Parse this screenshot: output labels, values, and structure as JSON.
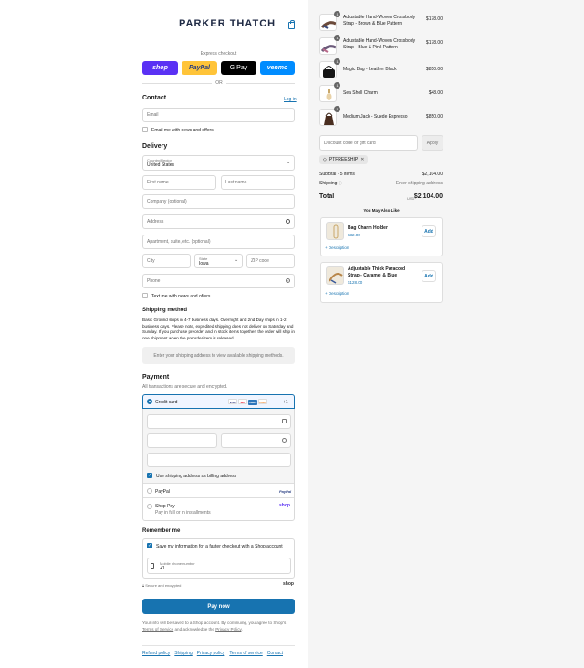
{
  "brand": {
    "logo": "PARKER THATCH"
  },
  "express": {
    "label": "Express checkout",
    "buttons": [
      {
        "label": "shop",
        "color": "#5a31f4"
      },
      {
        "label": "PayPal",
        "color": "#ffc439"
      },
      {
        "label": "G Pay",
        "color": "#000000"
      },
      {
        "label": "venmo",
        "color": "#008cff"
      }
    ],
    "or": "OR"
  },
  "contact": {
    "heading": "Contact",
    "login": "Log in",
    "email_placeholder": "Email",
    "news_label": "Email me with news and offers"
  },
  "delivery": {
    "heading": "Delivery",
    "country_label": "Country/Region",
    "country_value": "United States",
    "first_name": "First name",
    "last_name": "Last name",
    "company": "Company (optional)",
    "address": "Address",
    "apartment": "Apartment, suite, etc. (optional)",
    "city": "City",
    "state_label": "State",
    "state_value": "Iowa",
    "zip": "ZIP code",
    "phone": "Phone",
    "text_label": "Text me with news and offers"
  },
  "shipping": {
    "heading": "Shipping method",
    "body": "Basic Ground ships in 4-7 business days. Overnight and 2nd Day ships in 1-2 business days. Please note, expedited shipping does not deliver on Saturday and Sunday. If you purchase preorder and in stock items together, the order will ship in one shipment when the preorder item is released.",
    "note": "Enter your shipping address to view available shipping methods."
  },
  "payment": {
    "heading": "Payment",
    "sub": "All transactions are secure and encrypted.",
    "credit_card": "Credit card",
    "cards": [
      "VISA",
      "MC",
      "AMEX",
      "DISC"
    ],
    "more_cards": "+1",
    "billing_label": "Use shipping address as billing address",
    "paypal": "PayPal",
    "paypal_logo": "PayPal",
    "shop_pay": "Shop Pay",
    "shop_pay_sub": "Pay in full or in installments",
    "shop_logo": "shop"
  },
  "remember": {
    "heading": "Remember me",
    "save_label": "Save my information for a faster checkout with a Shop account",
    "phone_label": "Mobile phone number",
    "phone_value": "+1",
    "secure": "Secure and encrypted",
    "shop": "shop"
  },
  "pay_now": "Pay now",
  "legal": {
    "text1": "Your info will be saved to a Shop account. By continuing, you agree to Shop's",
    "terms": "Terms of Service",
    "text2": "and acknowledge the",
    "privacy": "Privacy Policy",
    "text3": "."
  },
  "footer_links": [
    "Refund policy",
    "Shipping",
    "Privacy policy",
    "Terms of service",
    "Contact"
  ],
  "cart": {
    "items": [
      {
        "name": "Adjustable Hand-Woven Crossbody Strap - Brown & Blue Pattern",
        "price": "$178.00",
        "qty": "1"
      },
      {
        "name": "Adjustable Hand-Woven Crossbody Strap - Blue & Pink Pattern",
        "price": "$178.00",
        "qty": "1"
      },
      {
        "name": "Magic Bag - Leather Black",
        "price": "$850.00",
        "qty": "1"
      },
      {
        "name": "Sea Shell Charm",
        "price": "$48.00",
        "qty": "1"
      },
      {
        "name": "Medium Jack - Suede Espresso",
        "price": "$850.00",
        "qty": "1"
      }
    ],
    "discount_placeholder": "Discount code or gift card",
    "apply": "Apply",
    "code": "PTFREESHIP",
    "subtotal_label": "Subtotal · 5 items",
    "subtotal": "$2,104.00",
    "shipping_label": "Shipping",
    "shipping_value": "Enter shipping address",
    "total_label": "Total",
    "currency": "USD",
    "total": "$2,104.00",
    "recs_heading": "You May Also Like",
    "recs": [
      {
        "name": "Bag Charm Holder",
        "price": "$32.00",
        "add": "Add",
        "desc": "Description"
      },
      {
        "name": "Adjustable Thick Paracord Strap - Caramel & Blue",
        "price": "$128.00",
        "add": "Add",
        "desc": "Description"
      }
    ]
  }
}
